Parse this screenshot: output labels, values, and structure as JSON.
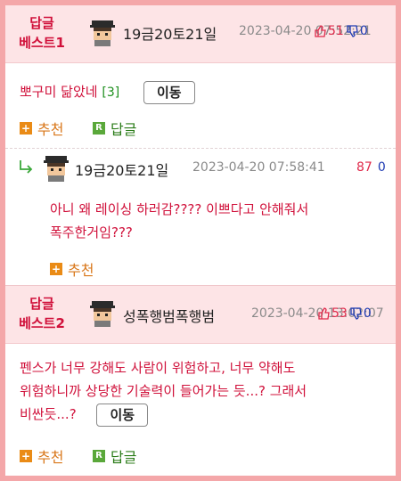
{
  "best1": {
    "badge_line1": "답글",
    "badge_line2": "베스트1",
    "nickname": "19금20토21일",
    "date": "2023-04-20 07:52:21",
    "upvotes": "51",
    "downvotes": "0",
    "text": "뽀구미 닮았네",
    "reply_count": "[3]",
    "move_label": "이동",
    "recommend_label": "추천",
    "reply_label": "답글"
  },
  "reply": {
    "nickname": "19금20토21일",
    "date": "2023-04-20 07:58:41",
    "upvotes": "87",
    "downvotes": "0",
    "text_line1": "아니 왜 레이싱 하러감???? 이쁘다고 안해줘서",
    "text_line2": "폭주한거임???",
    "recommend_label": "추천"
  },
  "best2": {
    "badge_line1": "답글",
    "badge_line2": "베스트2",
    "nickname": "성폭행범폭행범",
    "date": "2023-04-20 13:02:07",
    "upvotes": "53",
    "downvotes": "0",
    "text_line1": "펜스가 너무 강해도 사람이 위험하고, 너무 약해도",
    "text_line2": "위험하니까 상당한 기술력이 들어가는 듯...? 그래서",
    "text_line3": "비싼듯...?",
    "move_label": "이동",
    "recommend_label": "추천",
    "reply_label": "답글"
  },
  "colors": {
    "frame": "#f4a7a9",
    "header_bg": "#fde4e6",
    "accent_red": "#d0103a",
    "upvote": "#e02a4b",
    "downvote": "#1f3bb3"
  }
}
